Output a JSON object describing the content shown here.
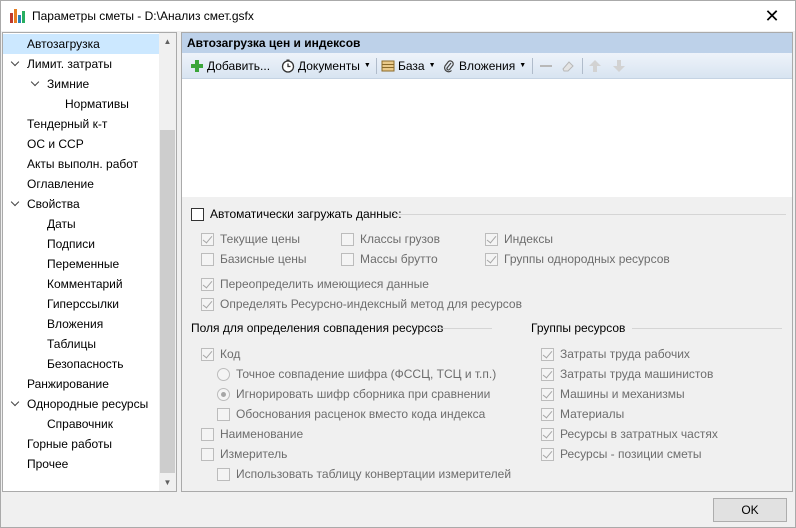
{
  "window": {
    "title": "Параметры сметы - D:\\Анализ смет.gsfx",
    "close_glyph": "✕"
  },
  "tree": {
    "items": [
      {
        "label": "Автозагрузка",
        "level": 0,
        "expandable": false,
        "selected": true
      },
      {
        "label": "Лимит. затраты",
        "level": 0,
        "expandable": true
      },
      {
        "label": "Зимние",
        "level": 1,
        "expandable": true
      },
      {
        "label": "Нормативы",
        "level": 2,
        "expandable": false
      },
      {
        "label": "Тендерный к-т",
        "level": 0,
        "expandable": false
      },
      {
        "label": "ОС и ССР",
        "level": 0,
        "expandable": false
      },
      {
        "label": "Акты выполн. работ",
        "level": 0,
        "expandable": false
      },
      {
        "label": "Оглавление",
        "level": 0,
        "expandable": false
      },
      {
        "label": "Свойства",
        "level": 0,
        "expandable": true
      },
      {
        "label": "Даты",
        "level": 1,
        "expandable": false
      },
      {
        "label": "Подписи",
        "level": 1,
        "expandable": false
      },
      {
        "label": "Переменные",
        "level": 1,
        "expandable": false
      },
      {
        "label": "Комментарий",
        "level": 1,
        "expandable": false
      },
      {
        "label": "Гиперссылки",
        "level": 1,
        "expandable": false
      },
      {
        "label": "Вложения",
        "level": 1,
        "expandable": false
      },
      {
        "label": "Таблицы",
        "level": 1,
        "expandable": false
      },
      {
        "label": "Безопасность",
        "level": 1,
        "expandable": false
      },
      {
        "label": "Ранжирование",
        "level": 0,
        "expandable": false
      },
      {
        "label": "Однородные ресурсы",
        "level": 0,
        "expandable": true
      },
      {
        "label": "Справочник",
        "level": 1,
        "expandable": false
      },
      {
        "label": "Горные работы",
        "level": 0,
        "expandable": false
      },
      {
        "label": "Прочее",
        "level": 0,
        "expandable": false
      }
    ]
  },
  "panel": {
    "header": "Автозагрузка цен и индексов",
    "toolbar": {
      "add": "Добавить...",
      "documents": "Документы",
      "base": "База",
      "attachments": "Вложения"
    }
  },
  "autoload": {
    "label": "Автоматически загружать данные:",
    "checked": false,
    "options": [
      {
        "label": "Текущие цены",
        "checked": true
      },
      {
        "label": "Классы грузов",
        "checked": false
      },
      {
        "label": "Индексы",
        "checked": true
      },
      {
        "label": "Базисные цены",
        "checked": false
      },
      {
        "label": "Массы брутто",
        "checked": false
      },
      {
        "label": "Группы однородных ресурсов",
        "checked": true
      },
      {
        "label": "Переопределить имеющиеся данные",
        "checked": true
      },
      {
        "label": "Определять Ресурсно-индексный метод для ресурсов",
        "checked": true
      }
    ]
  },
  "match_fields": {
    "title": "Поля для определения совпадения ресурсов",
    "code": {
      "label": "Код",
      "checked": true
    },
    "exact": {
      "label": "Точное совпадение шифра (ФССЦ, ТСЦ и т.п.)",
      "selected": false
    },
    "ignore": {
      "label": "Игнорировать шифр сборника при сравнении",
      "selected": true
    },
    "justify": {
      "label": "Обоснования расценок вместо кода индекса",
      "checked": false
    },
    "name": {
      "label": "Наименование",
      "checked": false
    },
    "unit": {
      "label": "Измеритель",
      "checked": false
    },
    "convert": {
      "label": "Использовать таблицу конвертации измерителей",
      "checked": false
    }
  },
  "resource_groups": {
    "title": "Группы ресурсов",
    "items": [
      {
        "label": "Затраты труда рабочих",
        "checked": true
      },
      {
        "label": "Затраты труда машинистов",
        "checked": true
      },
      {
        "label": "Машины и механизмы",
        "checked": true
      },
      {
        "label": "Материалы",
        "checked": true
      },
      {
        "label": "Ресурсы в затратных частях",
        "checked": true
      },
      {
        "label": "Ресурсы - позиции сметы",
        "checked": true
      }
    ]
  },
  "footer": {
    "ok": "OK"
  }
}
